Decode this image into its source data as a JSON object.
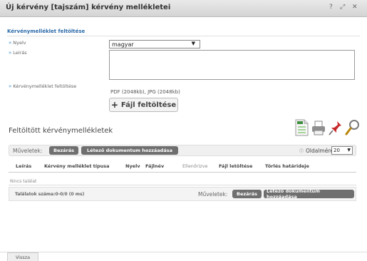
{
  "window": {
    "title": "Új kérvény [tajszám] kérvény mellékletei",
    "controls": {
      "help": "?",
      "popout": "⤢",
      "close": "✕"
    }
  },
  "section": {
    "heading": "Kérvénymelléklet feltöltése"
  },
  "form": {
    "language_label": "Nyelv",
    "language_value": "magyar",
    "description_label": "Leírás",
    "description_value": "",
    "upload_label": "Kérvénymelléklet feltöltése",
    "format_hint": "PDF (2048kb), JPG (2048kb)",
    "upload_button": "Fájl feltöltése"
  },
  "list": {
    "title": "Feltöltött kérvénymellékletek",
    "icons": [
      "excel-export-icon",
      "print-icon",
      "pin-icon",
      "search-icon"
    ]
  },
  "toolbar": {
    "actions_label": "Műveletek:",
    "close_button": "Bezárás",
    "add_existing_button": "Létező dokumentum hozzáadása",
    "page_size_label": "Oldalméret",
    "page_size_value": "20"
  },
  "table": {
    "columns": [
      "Leírás",
      "Kérvény melléklet típusa",
      "Nyelv",
      "Fájlnév",
      "Ellenőrizve",
      "Fájl letöltése",
      "Törlés határideje"
    ],
    "empty_text": "Nincs találat"
  },
  "footer": {
    "stats": "Találatok száma:0-0/0 (0 ms)",
    "actions_label": "Műveletek:",
    "close_button": "Bezárás",
    "add_existing_button": "Létező dokumentum hozzáadása"
  },
  "bottom": {
    "back_tab": "Vissza"
  },
  "colors": {
    "accent": "#2b6aa8",
    "pill": "#6f6f6f"
  }
}
